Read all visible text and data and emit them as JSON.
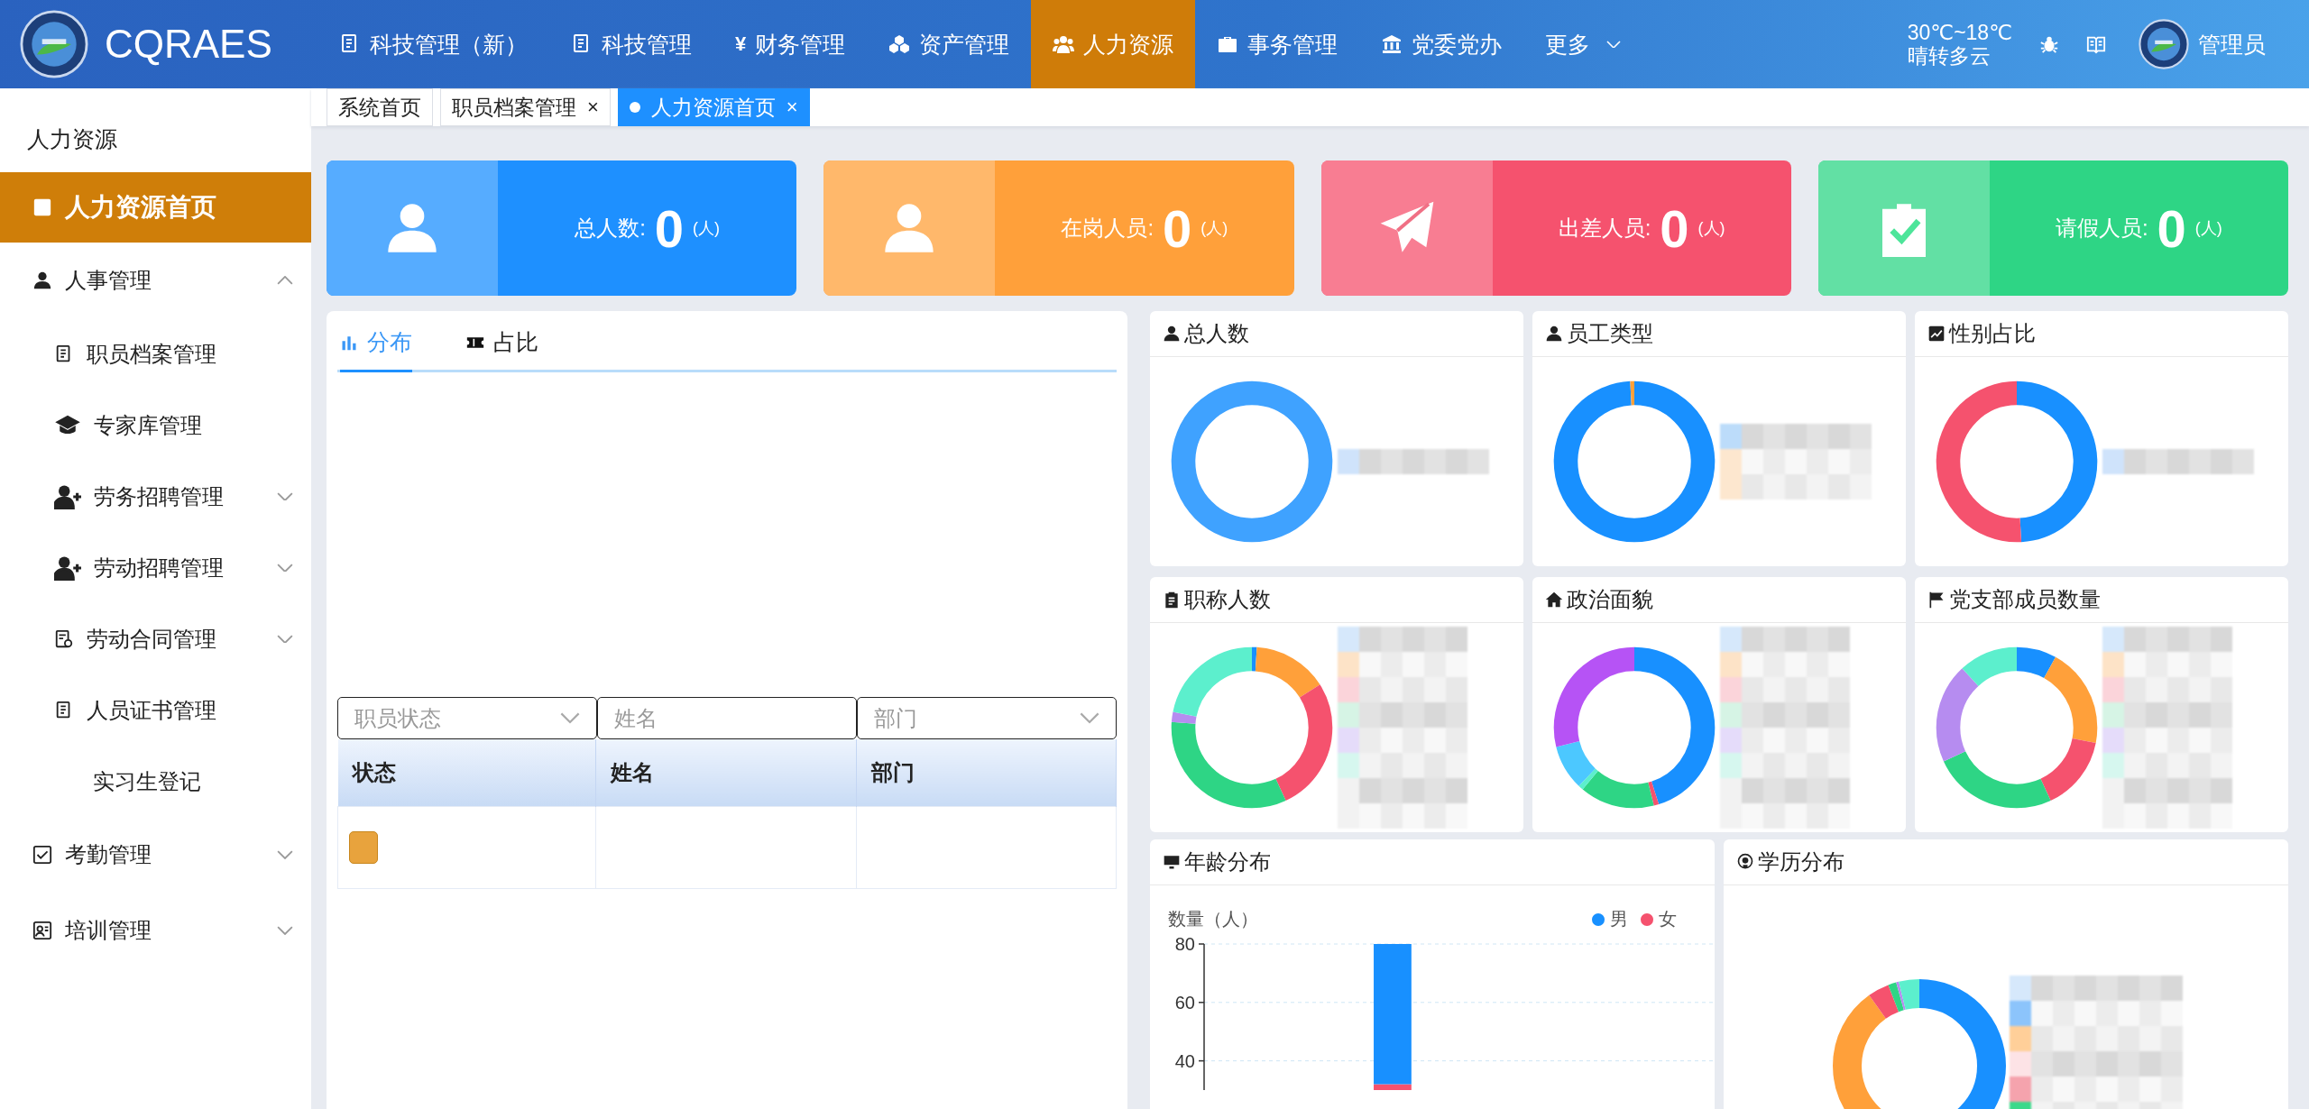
{
  "header": {
    "logo_text": "CQRAES",
    "nav": [
      {
        "label": "科技管理（新）",
        "selected": false
      },
      {
        "label": "科技管理",
        "selected": false
      },
      {
        "label": "财务管理",
        "glyph": "¥",
        "selected": false
      },
      {
        "label": "资产管理",
        "selected": false
      },
      {
        "label": "人力资源",
        "selected": true
      },
      {
        "label": "事务管理",
        "selected": false
      },
      {
        "label": "党委党办",
        "selected": false
      }
    ],
    "more": "更多",
    "weather": {
      "temp": "30℃~18℃",
      "desc": "晴转多云"
    },
    "user": "管理员"
  },
  "tabs": [
    {
      "label": "系统首页",
      "selected": false
    },
    {
      "label": "职员档案管理",
      "close": "×",
      "selected": false
    },
    {
      "label": "人力资源首页",
      "close": "×",
      "selected": true
    }
  ],
  "sidebar": {
    "title": "人力资源",
    "items": [
      {
        "label": "人力资源首页",
        "kind": "link",
        "selected": true
      },
      {
        "label": "人事管理",
        "kind": "group",
        "expanded": true,
        "selected": false,
        "children": [
          {
            "label": "职员档案管理",
            "kind": "link",
            "selected": false
          },
          {
            "label": "专家库管理",
            "kind": "link",
            "selected": false
          },
          {
            "label": "劳务招聘管理",
            "kind": "group",
            "expanded": false,
            "selected": false
          },
          {
            "label": "劳动招聘管理",
            "kind": "group",
            "expanded": false,
            "selected": false
          },
          {
            "label": "劳动合同管理",
            "kind": "group",
            "expanded": false,
            "selected": false
          },
          {
            "label": "人员证书管理",
            "kind": "link",
            "selected": false
          },
          {
            "label": "实习生登记",
            "kind": "link",
            "selected": false
          }
        ]
      },
      {
        "label": "考勤管理",
        "kind": "group",
        "expanded": false,
        "selected": false
      },
      {
        "label": "培训管理",
        "kind": "group",
        "expanded": false,
        "selected": false
      }
    ]
  },
  "stats": [
    {
      "label": "总人数:",
      "value": "0",
      "unit": "(人)",
      "color": "#1e90ff"
    },
    {
      "label": "在岗人员:",
      "value": "0",
      "unit": "(人)",
      "color": "#ffa03a"
    },
    {
      "label": "出差人员:",
      "value": "0",
      "unit": "(人)",
      "color": "#f5526e"
    },
    {
      "label": "请假人员:",
      "value": "0",
      "unit": "(人)",
      "color": "#2ed585"
    }
  ],
  "staff_panel": {
    "tabs": [
      {
        "label": "分布",
        "selected": true
      },
      {
        "label": "占比",
        "selected": false
      }
    ],
    "filters": [
      {
        "kind": "select",
        "placeholder": "职员状态"
      },
      {
        "kind": "input",
        "placeholder": "姓名"
      },
      {
        "kind": "select",
        "placeholder": "部门"
      }
    ],
    "table": {
      "columns": [
        "状态",
        "姓名",
        "部门"
      ],
      "rows": [
        {
          "color": "#e8a33d"
        }
      ]
    }
  },
  "chart_cards": [
    {
      "title": "总人数"
    },
    {
      "title": "员工类型"
    },
    {
      "title": "性别占比"
    },
    {
      "title": "职称人数"
    },
    {
      "title": "政治面貌"
    },
    {
      "title": "党支部成员数量"
    }
  ],
  "age_card": {
    "title": "年龄分布",
    "chart_data": {
      "type": "bar",
      "stacked": true,
      "ylabel": "数量（人）",
      "ylim": [
        30,
        80
      ],
      "yticks": [
        40,
        60,
        80
      ],
      "series": [
        {
          "name": "男",
          "color": "#1890ff",
          "values": [
            null,
            null,
            48,
            null,
            null,
            null,
            null
          ]
        },
        {
          "name": "女",
          "color": "#f5526e",
          "values": [
            null,
            null,
            32,
            null,
            null,
            null,
            null
          ]
        }
      ]
    }
  },
  "education_card": {
    "title": "学历分布"
  }
}
